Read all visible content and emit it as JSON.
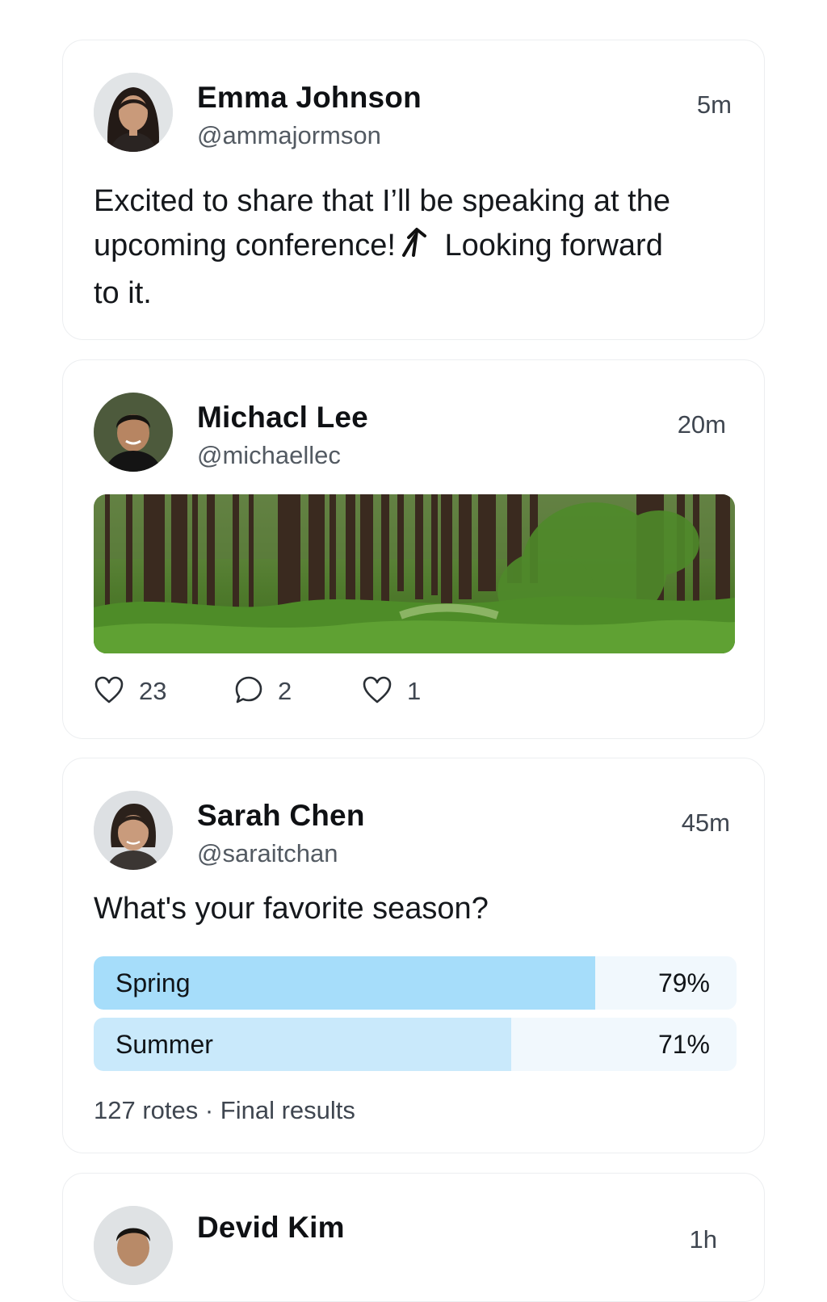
{
  "posts": [
    {
      "name": "Emma Johnson",
      "handle": "@ammajormson",
      "time": "5m",
      "text_line1": "Excited to share that I’ll be speaking at the",
      "text_line2a": "upcoming conference!",
      "text_line2b": "Looking forward",
      "text_line3": "to it.",
      "inline_icon": "arrow-up-icon"
    },
    {
      "name": "Michacl Lee",
      "handle": "@michaellec",
      "time": "20m",
      "image": "forest-photo",
      "actions": [
        {
          "icon": "heart-icon",
          "count": "23"
        },
        {
          "icon": "comment-icon",
          "count": "2"
        },
        {
          "icon": "heart-icon",
          "count": "1"
        }
      ]
    },
    {
      "name": "Sarah Chen",
      "handle": "@saraitchan",
      "time": "45m",
      "question": "What's your favorite season?",
      "poll": [
        {
          "label": "Spring",
          "percent_text": "79%",
          "fill_fraction": 0.78,
          "color": "#a6ddfa"
        },
        {
          "label": "Summer",
          "percent_text": "71%",
          "fill_fraction": 0.65,
          "color": "#c9e9fb"
        }
      ],
      "meta": "127 rotes · Final results"
    },
    {
      "name": "Devid Kim",
      "time": "1h"
    }
  ],
  "colors": {
    "card_border": "#eceef0",
    "poll_track": "#f1f8fd",
    "secondary_text": "#535a62"
  }
}
